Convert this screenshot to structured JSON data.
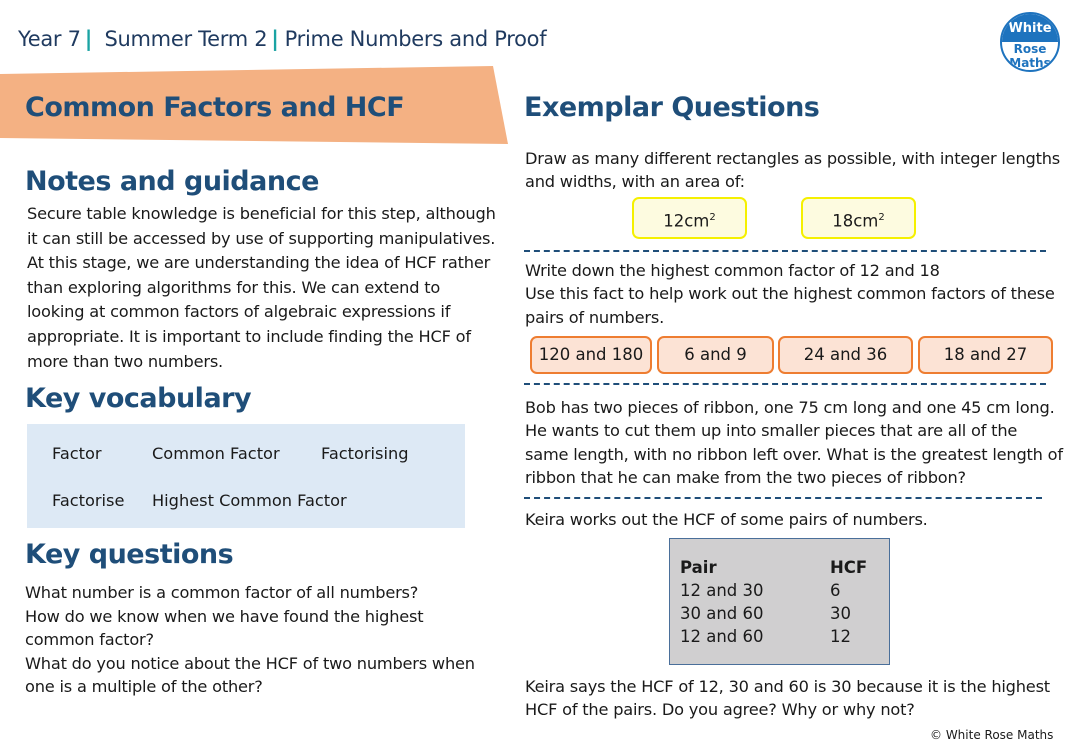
{
  "header": {
    "breadcrumb": [
      "Year 7",
      "Summer Term 2",
      "Prime Numbers and Proof"
    ],
    "logo": {
      "line1": "White",
      "line2": "Rose",
      "line3": "Maths"
    }
  },
  "banner": {
    "title": "Common Factors and HCF",
    "color": "#f4b183"
  },
  "left": {
    "notes": {
      "heading": "Notes and guidance",
      "lines": [
        "Secure table knowledge is beneficial for this step, although",
        "it can still be accessed by use of supporting manipulatives.",
        "At this stage, we are understanding the idea of HCF rather",
        "than exploring algorithms for this. We can extend to",
        "looking at common factors of algebraic expressions if",
        "appropriate. It is important to include finding the HCF of",
        "more than two numbers."
      ]
    },
    "vocabulary": {
      "heading": "Key vocabulary",
      "terms": [
        "Factor",
        "Common Factor",
        "Factorising",
        "Factorise",
        "Highest Common Factor"
      ]
    },
    "questions": {
      "heading": "Key questions",
      "lines": [
        "What number is a common factor of all numbers?",
        "How do we know when we have found the highest",
        "common factor?",
        "What do you notice about the HCF of two numbers when",
        "one is a multiple of the other?"
      ]
    }
  },
  "right": {
    "heading": "Exemplar Questions",
    "q1": {
      "lines": [
        "Draw as many different rectangles as possible, with integer lengths",
        "and widths, with an area of:"
      ],
      "boxes": [
        {
          "value": "12cm",
          "sup": "2"
        },
        {
          "value": "18cm",
          "sup": "2"
        }
      ]
    },
    "q2": {
      "lines": [
        "Write down the highest common factor of 12 and 18",
        "Use this fact to help work out the highest common factors of these",
        "pairs of numbers."
      ],
      "boxes": [
        "120 and 180",
        "6 and 9",
        "24 and 36",
        "18 and 27"
      ]
    },
    "q3": {
      "lines": [
        "Bob has two pieces of ribbon, one 75 cm long and one 45 cm long.",
        "He wants to cut them up into smaller pieces that are all of the",
        "same length, with no ribbon left over. What is the greatest length of",
        "ribbon that he can make from the two pieces of ribbon?"
      ]
    },
    "q4": {
      "intro": "Keira works out the HCF of some pairs of numbers.",
      "table": {
        "headers": [
          "Pair",
          "HCF"
        ],
        "rows": [
          [
            "12 and 30",
            "6"
          ],
          [
            "30 and 60",
            "30"
          ],
          [
            "12 and 60",
            "12"
          ]
        ]
      },
      "lines": [
        "Keira says the HCF of 12, 30 and 60 is 30 because it is the highest",
        "HCF of the pairs. Do you agree? Why or why not?"
      ]
    }
  },
  "footer": {
    "copyright": "© White Rose Maths"
  }
}
